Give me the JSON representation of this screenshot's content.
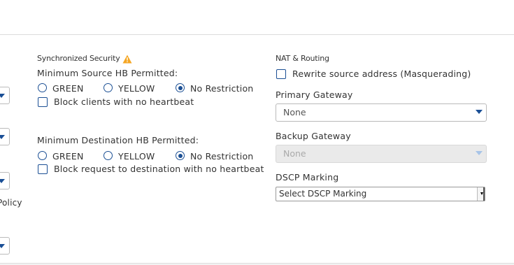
{
  "left_column": {
    "cutoff_label": "Policy"
  },
  "synchronized_security": {
    "title": "Synchronized Security",
    "warning_icon": "warning-icon",
    "source": {
      "label": "Minimum Source HB Permitted:",
      "options": [
        "GREEN",
        "YELLOW",
        "No Restriction"
      ],
      "selected": "No Restriction",
      "checkbox_label": "Block clients with no heartbeat",
      "checkbox_checked": false
    },
    "destination": {
      "label": "Minimum Destination HB Permitted:",
      "options": [
        "GREEN",
        "YELLOW",
        "No Restriction"
      ],
      "selected": "No Restriction",
      "checkbox_label": "Block request to destination with no heartbeat",
      "checkbox_checked": false
    }
  },
  "nat_routing": {
    "title": "NAT & Routing",
    "masquerade_label": "Rewrite source address (Masquerading)",
    "masquerade_checked": false,
    "primary_gateway": {
      "label": "Primary Gateway",
      "value": "None"
    },
    "backup_gateway": {
      "label": "Backup Gateway",
      "value": "None",
      "disabled": true
    },
    "dscp": {
      "label": "DSCP Marking",
      "value": "Select DSCP Marking"
    }
  },
  "colors": {
    "accent": "#1b4f94",
    "warning": "#f5a623"
  }
}
